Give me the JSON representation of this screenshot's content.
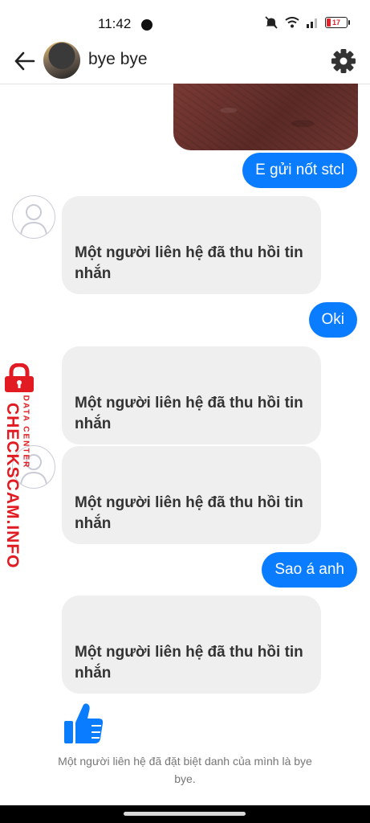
{
  "status_bar": {
    "time": "11:42",
    "battery": "17"
  },
  "header": {
    "contact_name": "bye bye"
  },
  "messages": {
    "sent_1": "E gửi nốt stcl",
    "recalled_1": "Một người liên hệ đã thu hồi tin nhắn",
    "sent_2": "Oki",
    "recalled_2": "Một người liên hệ đã thu hồi tin nhắn",
    "recalled_3": "Một người liên hệ đã thu hồi tin nhắn",
    "sent_3": "Sao á anh",
    "recalled_4": "Một người liên hệ đã thu hồi tin nhắn"
  },
  "system_note": "Một người liên hệ đã đặt biệt danh của mình là bye bye.",
  "watermark": {
    "main": "CHECKSCAM.INFO",
    "sub": "DATA CENTER"
  },
  "colors": {
    "accent": "#0a7cff",
    "bubble_received": "#efefef",
    "watermark": "#e21b22"
  }
}
